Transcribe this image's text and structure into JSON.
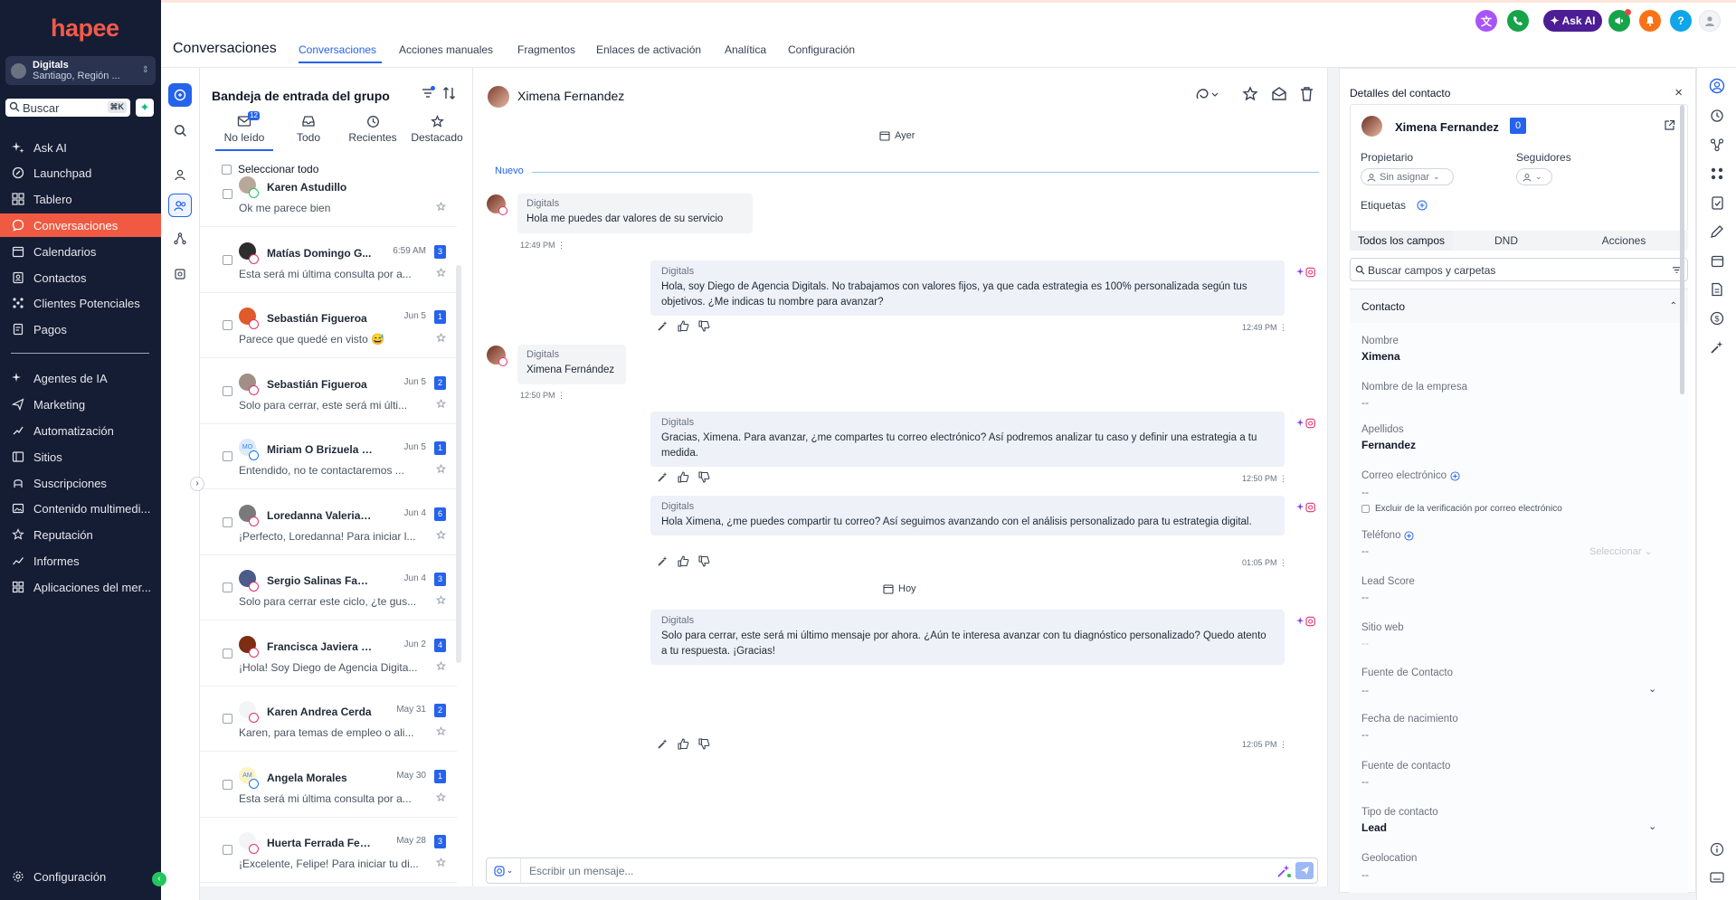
{
  "brand": {
    "logo_text": "hapee",
    "accent": "#f05a42"
  },
  "account": {
    "name": "Digitals",
    "location": "Santiago, Región ..."
  },
  "search": {
    "placeholder": "Buscar",
    "shortcut": "⌘K"
  },
  "nav": {
    "items": [
      {
        "label": "Ask AI",
        "icon": "sparkle-icon"
      },
      {
        "label": "Launchpad",
        "icon": "launchpad-icon"
      },
      {
        "label": "Tablero",
        "icon": "dashboard-icon"
      },
      {
        "label": "Conversaciones",
        "icon": "chat-icon",
        "active": true
      },
      {
        "label": "Calendarios",
        "icon": "calendar-icon"
      },
      {
        "label": "Contactos",
        "icon": "contacts-icon"
      },
      {
        "label": "Clientes Potenciales",
        "icon": "pipeline-icon"
      },
      {
        "label": "Pagos",
        "icon": "payments-icon"
      }
    ],
    "items2": [
      {
        "label": "Agentes de IA",
        "icon": "ai-agent-icon"
      },
      {
        "label": "Marketing",
        "icon": "send-icon"
      },
      {
        "label": "Automatización",
        "icon": "automation-icon"
      },
      {
        "label": "Sitios",
        "icon": "sites-icon"
      },
      {
        "label": "Suscripciones",
        "icon": "subscriptions-icon"
      },
      {
        "label": "Contenido multimedi...",
        "icon": "media-icon"
      },
      {
        "label": "Reputación",
        "icon": "star-icon"
      },
      {
        "label": "Informes",
        "icon": "reports-icon"
      },
      {
        "label": "Aplicaciones del mer...",
        "icon": "apps-icon"
      }
    ],
    "settings": "Configuración"
  },
  "header": {
    "title": "Conversaciones",
    "tabs": [
      "Conversaciones",
      "Acciones manuales",
      "Fragmentos",
      "Enlaces de activación",
      "Analítica",
      "Configuración"
    ],
    "ask_ai": "Ask AI"
  },
  "inbox": {
    "title": "Bandeja de entrada del grupo",
    "tabs": [
      {
        "label": "No leído",
        "badge": "12"
      },
      {
        "label": "Todo"
      },
      {
        "label": "Recientes"
      },
      {
        "label": "Destacado"
      }
    ],
    "select_all": "Seleccionar todo",
    "conversations": [
      {
        "name": "Karen Astudillo",
        "date": "",
        "count": "",
        "preview": "Ok me parece bien",
        "channel": "wa",
        "avatar": "#b8a89a"
      },
      {
        "name": "Matías Domingo G...",
        "date": "6:59 AM",
        "count": "3",
        "preview": "Esta será mi última consulta por a...",
        "channel": "ig",
        "avatar": "#2d2d2d"
      },
      {
        "name": "Sebastián Figueroa",
        "date": "Jun 5",
        "count": "1",
        "preview": "Parece que quedé en visto 😅",
        "channel": "ig",
        "avatar": "#e05a2b"
      },
      {
        "name": "Sebastián Figueroa",
        "date": "Jun 5",
        "count": "2",
        "preview": "Solo para cerrar, este será mi últi...",
        "channel": "ig",
        "avatar": "#9f8f86"
      },
      {
        "name": "Miriam O Brizuela Bu...",
        "date": "Jun 5",
        "count": "1",
        "preview": "Entendido, no te contactaremos ...",
        "channel": "fb",
        "avatar": "#dbeafe",
        "initials": "MO"
      },
      {
        "name": "Loredanna Valeria V...",
        "date": "Jun 4",
        "count": "6",
        "preview": "¡Perfecto, Loredanna! Para iniciar l...",
        "channel": "ig",
        "avatar": "#7a7a7a"
      },
      {
        "name": "Sergio Salinas Faún...",
        "date": "Jun 4",
        "count": "3",
        "preview": "Solo para cerrar este ciclo, ¿te gus...",
        "channel": "ig",
        "avatar": "#4b5b8a"
      },
      {
        "name": "Francisca Javiera Pl...",
        "date": "Jun 2",
        "count": "4",
        "preview": "¡Hola! Soy Diego de Agencia Digita...",
        "channel": "ig",
        "avatar": "#7c2d12"
      },
      {
        "name": "Karen Andrea Cerda",
        "date": "May 31",
        "count": "2",
        "preview": "Karen, para temas de empleo o ali...",
        "channel": "ig",
        "avatar": "#f3f4f6"
      },
      {
        "name": "Angela Morales",
        "date": "May 30",
        "count": "1",
        "preview": "Esta será mi última consulta por a...",
        "channel": "fb",
        "avatar": "#fef3c7",
        "initials": "AM"
      },
      {
        "name": "Huerta Ferrada Feli...",
        "date": "May 28",
        "count": "3",
        "preview": "¡Excelente, Felipe! Para iniciar tu di...",
        "channel": "ig",
        "avatar": "#f3f4f6"
      }
    ]
  },
  "chat": {
    "contact_name": "Ximena Fernandez",
    "day_yesterday": "Ayer",
    "day_today": "Hoy",
    "new_label": "Nuevo",
    "messages": [
      {
        "dir": "in",
        "from": "Digitals",
        "text": "Hola me puedes dar valores de su servicio",
        "time": "12:49 PM"
      },
      {
        "dir": "out",
        "from": "Digitals",
        "text": "Hola, soy Diego de Agencia Digitals. No trabajamos con valores fijos, ya que cada estrategia es 100% personalizada según tus objetivos. ¿Me indicas tu nombre para avanzar?",
        "time": "12:49 PM"
      },
      {
        "dir": "in",
        "from": "Digitals",
        "text": "Ximena Fernández",
        "time": "12:50 PM"
      },
      {
        "dir": "out",
        "from": "Digitals",
        "text": "Gracias, Ximena. Para avanzar, ¿me compartes tu correo electrónico? Así podremos analizar tu caso y definir una estrategia a tu medida.",
        "time": "12:50 PM"
      },
      {
        "dir": "out",
        "from": "Digitals",
        "text": "Hola Ximena, ¿me puedes compartir tu correo? Así seguimos avanzando con el análisis personalizado para tu estrategia digital.",
        "time": "01:05 PM"
      },
      {
        "dir": "out",
        "from": "Digitals",
        "text": "Solo para cerrar, este será mi último mensaje por ahora. ¿Aún te interesa avanzar con tu diagnóstico personalizado? Quedo atento a tu respuesta. ¡Gracias!",
        "time": "12:05 PM"
      }
    ],
    "composer_placeholder": "Escribir un mensaje..."
  },
  "contact_panel": {
    "title": "Detalles del contacto",
    "name": "Ximena Fernandez",
    "badge": "0",
    "owner_label": "Propietario",
    "owner_value": "Sin asignar",
    "followers_label": "Seguidores",
    "tags_label": "Etiquetas",
    "tabs": [
      "Todos los campos",
      "DND",
      "Acciones"
    ],
    "search_placeholder": "Buscar campos y carpetas",
    "section": "Contacto",
    "fields": [
      {
        "label": "Nombre",
        "value": "Ximena"
      },
      {
        "label": "Nombre de la empresa",
        "value": "--"
      },
      {
        "label": "Apellidos",
        "value": "Fernandez"
      },
      {
        "label": "Correo electrónico",
        "value": "--"
      },
      {
        "label": "Teléfono",
        "value": "--"
      },
      {
        "label": "Lead Score",
        "value": "--"
      },
      {
        "label": "Sitio web",
        "value": "--"
      },
      {
        "label": "Fuente de Contacto",
        "value": "--"
      },
      {
        "label": "Fecha de nacimiento",
        "value": "--"
      },
      {
        "label": "Fuente de contacto",
        "value": "--"
      },
      {
        "label": "Tipo de contacto",
        "value": "Lead"
      },
      {
        "label": "Geolocation",
        "value": "--"
      }
    ],
    "email_exclude": "Excluir de la verificación por correo electrónico",
    "phone_select": "Seleccionar"
  }
}
